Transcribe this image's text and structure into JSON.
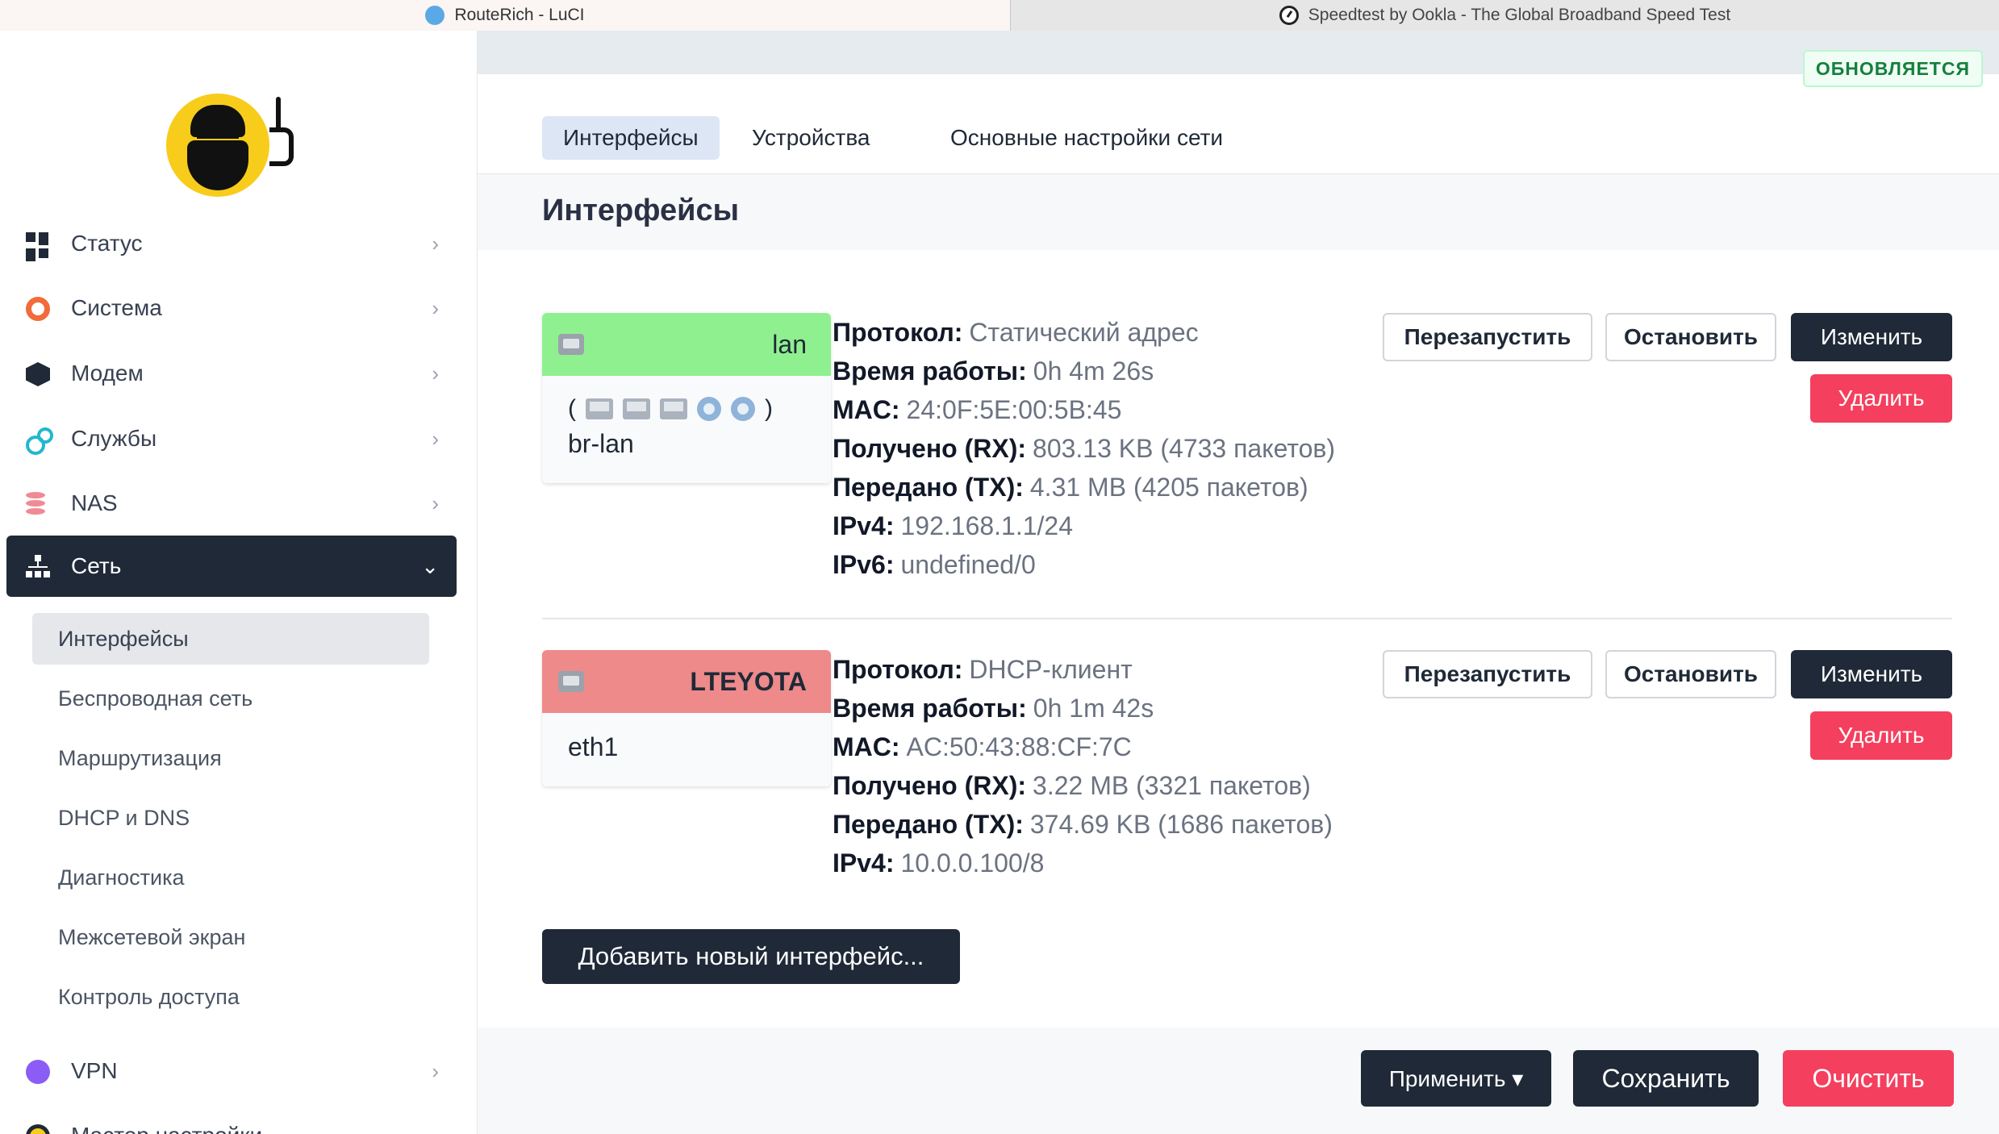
{
  "browser_tabs": [
    {
      "title": "RouteRich - LuCI"
    },
    {
      "title": "Speedtest by Ookla - The Global Broadband Speed Test"
    }
  ],
  "status_badge": "ОБНОВЛЯЕТСЯ",
  "sidebar": {
    "items": [
      {
        "label": "Статус",
        "icon": "dashboard-icon"
      },
      {
        "label": "Система",
        "icon": "gear-icon"
      },
      {
        "label": "Модем",
        "icon": "cube-icon"
      },
      {
        "label": "Службы",
        "icon": "services-gears-icon"
      },
      {
        "label": "NAS",
        "icon": "database-icon"
      },
      {
        "label": "Сеть",
        "icon": "network-icon"
      },
      {
        "label": "VPN",
        "icon": "vpn-icon"
      },
      {
        "label": "Мастер настройки",
        "icon": "wizard-icon"
      }
    ],
    "network_subitems": [
      {
        "label": "Интерфейсы"
      },
      {
        "label": "Беспроводная сеть"
      },
      {
        "label": "Маршрутизация"
      },
      {
        "label": "DHCP и DNS"
      },
      {
        "label": "Диагностика"
      },
      {
        "label": "Межсетевой экран"
      },
      {
        "label": "Контроль доступа"
      }
    ]
  },
  "page_tabs": [
    {
      "label": "Интерфейсы"
    },
    {
      "label": "Устройства"
    },
    {
      "label": "Основные настройки сети"
    }
  ],
  "page_title": "Интерфейсы",
  "interfaces": [
    {
      "name": "lan",
      "device_open": "(",
      "device_close": ")",
      "device": "br-lan",
      "info": [
        {
          "label": "Протокол:",
          "value": "Статический адрес"
        },
        {
          "label": "Время работы:",
          "value": "0h 4m 26s"
        },
        {
          "label": "MAC:",
          "value": "24:0F:5E:00:5B:45"
        },
        {
          "label": "Получено (RX):",
          "value": "803.13 KB (4733 пакетов)"
        },
        {
          "label": "Передано (TX):",
          "value": "4.31 MB (4205 пакетов)"
        },
        {
          "label": "IPv4:",
          "value": "192.168.1.1/24"
        },
        {
          "label": "IPv6:",
          "value": "undefined/0"
        }
      ],
      "head_color": "#8ff08f"
    },
    {
      "name": "LTEYOTA",
      "device": "eth1",
      "info": [
        {
          "label": "Протокол:",
          "value": "DHCP-клиент"
        },
        {
          "label": "Время работы:",
          "value": "0h 1m 42s"
        },
        {
          "label": "MAC:",
          "value": "AC:50:43:88:CF:7C"
        },
        {
          "label": "Получено (RX):",
          "value": "3.22 MB (3321 пакетов)"
        },
        {
          "label": "Передано (TX):",
          "value": "374.69 KB (1686 пакетов)"
        },
        {
          "label": "IPv4:",
          "value": "10.0.0.100/8"
        }
      ],
      "head_color": "#ee8a8a"
    }
  ],
  "actions": {
    "restart": "Перезапустить",
    "stop": "Остановить",
    "edit": "Изменить",
    "delete": "Удалить"
  },
  "add_interface": "Добавить новый интерфейс...",
  "footer": {
    "apply": "Применить ▾",
    "save": "Сохранить",
    "reset": "Очистить"
  },
  "colors": {
    "dark": "#1f2937",
    "danger": "#f43f5e",
    "lan": "#8ff08f",
    "wan": "#ee8a8a",
    "update_badge": "#15803d"
  }
}
